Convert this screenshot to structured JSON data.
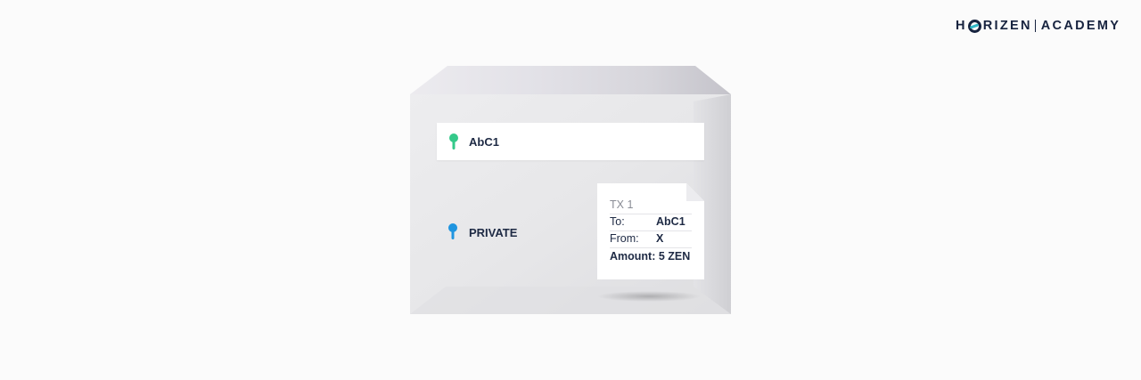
{
  "brand": {
    "letters_before": "H",
    "letters_after": "RIZEN",
    "suffix": "ACADEMY",
    "icon": "horizen-o-logo-icon"
  },
  "envelope": {
    "address_field": {
      "label": "AbC1",
      "icon": "key-icon",
      "color": "#34c98a"
    },
    "private_field": {
      "label": "PRIVATE",
      "icon": "key-icon",
      "color": "#1f95e0"
    }
  },
  "transaction": {
    "title": "TX 1",
    "rows": [
      {
        "key": "To:",
        "value": "AbC1"
      },
      {
        "key": "From:",
        "value": "X"
      }
    ],
    "amount_key": "Amount:",
    "amount_value": "5 ZEN"
  }
}
